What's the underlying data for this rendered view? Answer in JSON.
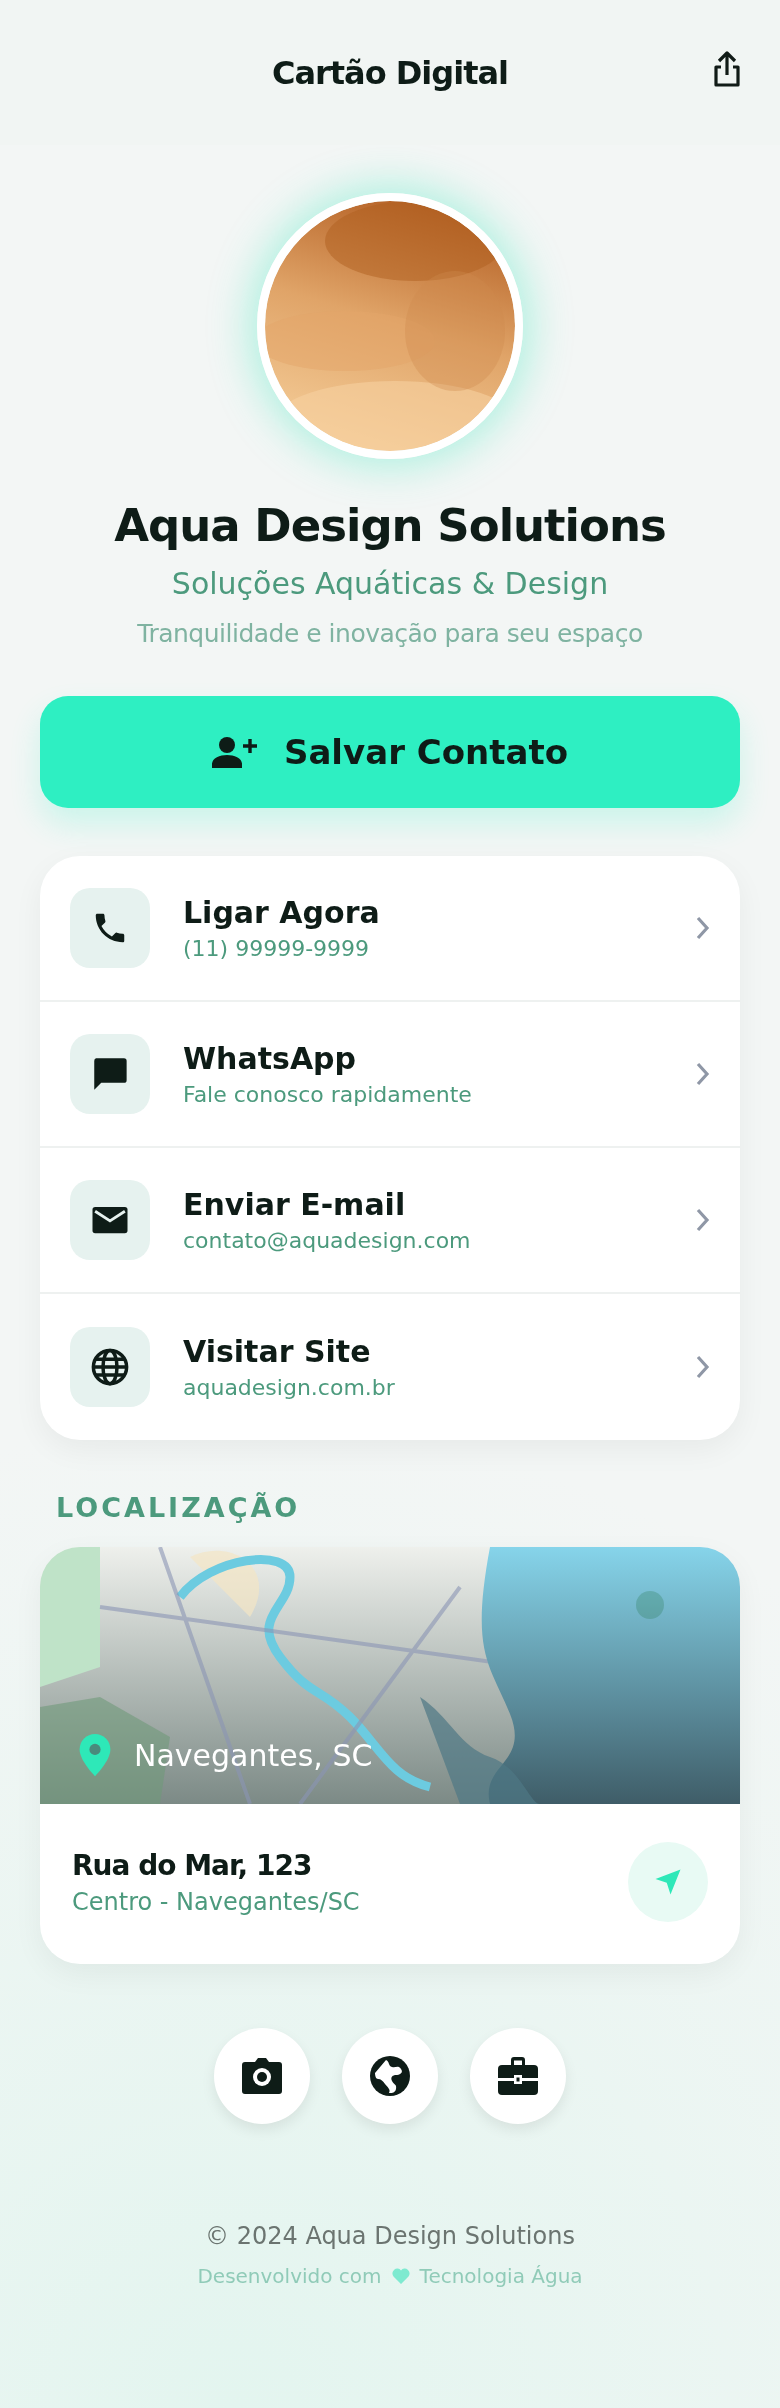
{
  "header": {
    "title": "Cartão Digital"
  },
  "profile": {
    "name": "Aqua Design Solutions",
    "subtitle": "Soluções Aquáticas & Design",
    "tagline": "Tranquilidade e inovação para seu espaço"
  },
  "save_button": {
    "label": "Salvar Contato"
  },
  "contacts": [
    {
      "title": "Ligar Agora",
      "detail": "(11) 99999-9999"
    },
    {
      "title": "WhatsApp",
      "detail": "Fale conosco rapidamente"
    },
    {
      "title": "Enviar E-mail",
      "detail": "contato@aquadesign.com"
    },
    {
      "title": "Visitar Site",
      "detail": "aquadesign.com.br"
    }
  ],
  "location": {
    "heading": "LOCALIZAÇÃO",
    "map_label": "Navegantes, SC",
    "street": "Rua do Mar, 123",
    "district": "Centro - Navegantes/SC"
  },
  "footer": {
    "copyright": "© 2024 Aqua Design Solutions",
    "made_with": "Desenvolvido com",
    "made_by": "Tecnologia Água"
  }
}
